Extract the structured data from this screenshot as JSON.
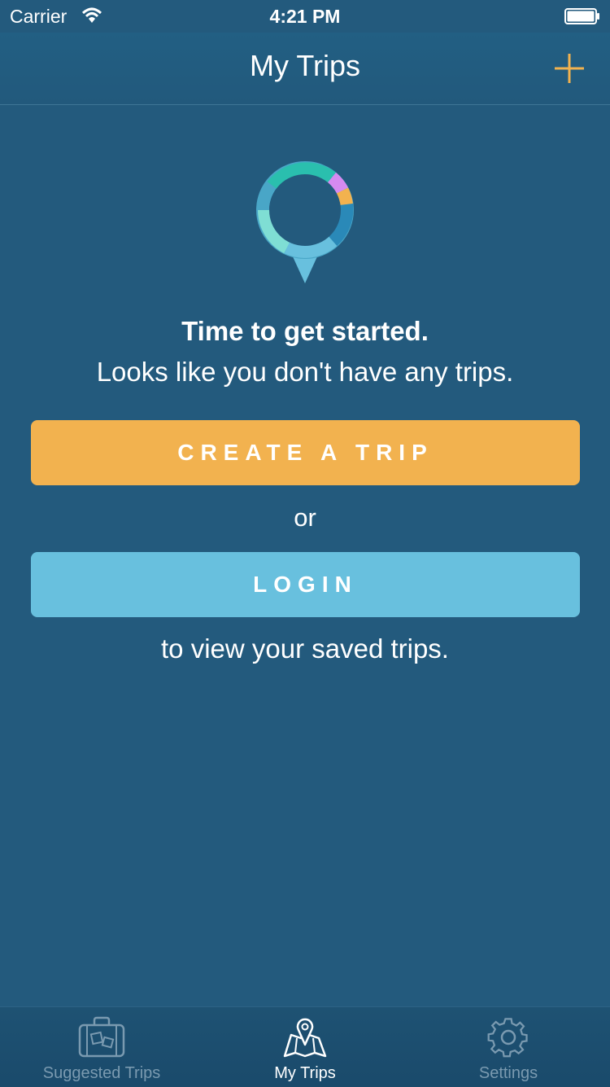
{
  "status_bar": {
    "carrier": "Carrier",
    "time": "4:21 PM"
  },
  "nav": {
    "title": "My Trips",
    "add_icon": "plus-icon"
  },
  "empty_state": {
    "logo_icon": "map-pin-ring-icon",
    "headline": "Time to get started.",
    "subline": "Looks like you don't have any trips.",
    "create_button": "CREATE A TRIP",
    "or_text": "or",
    "login_button": "LOGIN",
    "view_text": "to view your saved trips."
  },
  "tabs": [
    {
      "label": "Suggested Trips",
      "icon": "suitcase-icon",
      "active": false
    },
    {
      "label": "My Trips",
      "icon": "map-pin-icon",
      "active": true
    },
    {
      "label": "Settings",
      "icon": "gear-icon",
      "active": false
    }
  ],
  "colors": {
    "background": "#235a7d",
    "accent_orange": "#f2b24f",
    "accent_blue": "#68c0de",
    "tab_inactive": "#7a9ab0"
  }
}
